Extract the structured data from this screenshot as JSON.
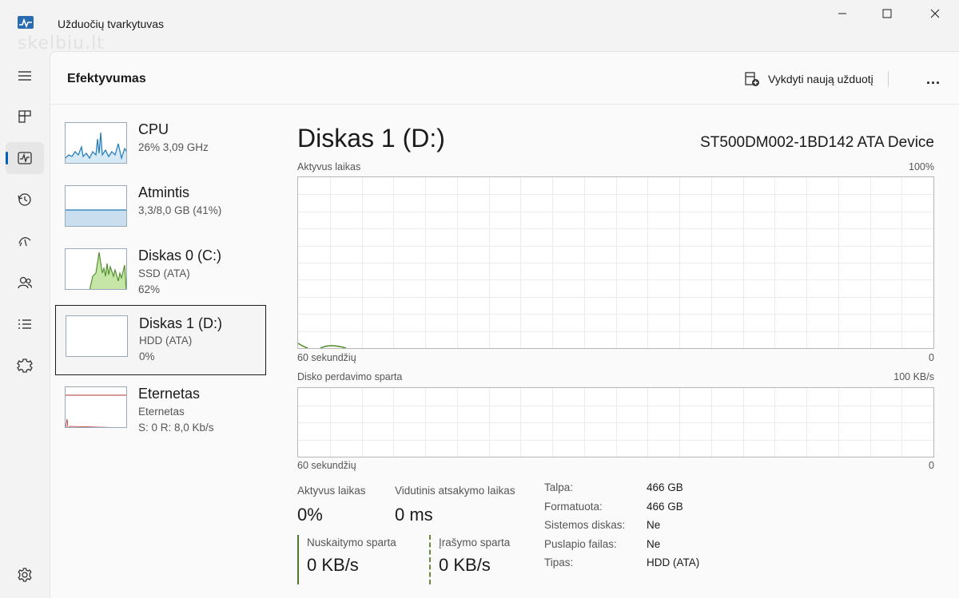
{
  "window": {
    "title": "Užduočių tvarkytuvas",
    "watermark": "skelbiu.lt"
  },
  "header": {
    "title": "Efektyvumas",
    "run_task_label": "Vykdyti naują užduotį",
    "more_label": "..."
  },
  "nav": {
    "items": [
      {
        "icon": "hamburger-menu-icon"
      },
      {
        "icon": "processes-icon"
      },
      {
        "icon": "performance-icon",
        "active": true
      },
      {
        "icon": "app-history-icon"
      },
      {
        "icon": "startup-apps-icon"
      },
      {
        "icon": "users-icon"
      },
      {
        "icon": "details-icon"
      },
      {
        "icon": "services-icon"
      },
      {
        "icon": "settings-icon"
      }
    ]
  },
  "devices": [
    {
      "name": "CPU",
      "sub": "26% 3,09 GHz",
      "val": ""
    },
    {
      "name": "Atmintis",
      "sub": "3,3/8,0 GB (41%)",
      "val": ""
    },
    {
      "name": "Diskas 0 (C:)",
      "sub": "SSD (ATA)",
      "val": "62%"
    },
    {
      "name": "Diskas 1 (D:)",
      "sub": "HDD (ATA)",
      "val": "0%",
      "selected": true
    },
    {
      "name": "Eternetas",
      "sub": "Eternetas",
      "val": "S: 0 R: 8,0 Kb/s"
    }
  ],
  "detail": {
    "title": "Diskas 1 (D:)",
    "model": "ST500DM002-1BD142 ATA Device",
    "graph1": {
      "label": "Aktyvus laikas",
      "max_label": "100%",
      "time_label": "60 sekundžių",
      "min_label": "0",
      "value_percent": 0
    },
    "graph2": {
      "label": "Disko perdavimo sparta",
      "max_label": "100 KB/s",
      "time_label": "60 sekundžių",
      "min_label": "0",
      "value_kbs": 0
    },
    "stats": {
      "active_time_label": "Aktyvus laikas",
      "active_time_value": "0%",
      "response_time_label": "Vidutinis atsakymo laikas",
      "response_time_value": "0 ms",
      "read_speed_label": "Nuskaitymo sparta",
      "read_speed_value": "0 KB/s",
      "write_speed_label": "Įrašymo sparta",
      "write_speed_value": "0 KB/s"
    },
    "properties": [
      {
        "key": "Talpa:",
        "value": "466 GB"
      },
      {
        "key": "Formatuota:",
        "value": "466 GB"
      },
      {
        "key": "Sistemos diskas:",
        "value": "Ne"
      },
      {
        "key": "Puslapio failas:",
        "value": "Ne"
      },
      {
        "key": "Tipas:",
        "value": "HDD (ATA)"
      }
    ]
  },
  "colors": {
    "accent": "#005fb8",
    "cpu_line": "#1f7ab8",
    "memory_fill": "#c9dff0",
    "disk_fill": "#c5e6a6",
    "disk_line": "#4a8a22",
    "net_line": "#b03030"
  }
}
